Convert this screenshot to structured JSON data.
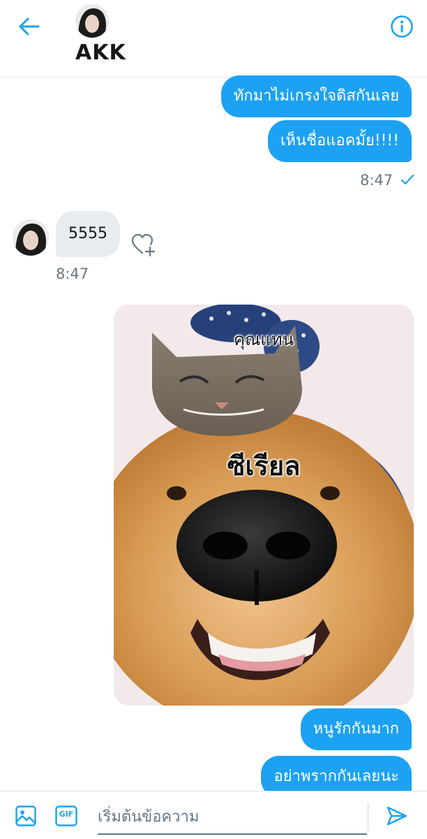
{
  "header": {
    "contact_name": "AKK"
  },
  "messages": {
    "out_1": "ทักมาไม่เกรงใจดิสกันเลย",
    "out_2": "เห็นชื่อแอคมั้ย!!!!",
    "out_time": "8:47",
    "in_1": "5555",
    "in_time": "8:47",
    "image_caption_top": "คุณแทน",
    "image_caption_mid": "ซีเรียล",
    "out_3": "หนูรักกันมาก",
    "out_4": "อย่าพรากกันเลยนะ"
  },
  "composer": {
    "placeholder": "เริ่มต้นข้อความ",
    "gif_label": "GIF"
  },
  "icons": {
    "back": "arrow-left-icon",
    "info": "info-icon",
    "like": "heart-plus-icon",
    "photo": "image-icon",
    "gif": "gif-icon",
    "send": "send-icon",
    "read_receipt": "check-icon"
  },
  "colors": {
    "accent": "#1da1f2",
    "incoming_bubble": "#e6ecf0",
    "secondary_text": "#657786"
  }
}
